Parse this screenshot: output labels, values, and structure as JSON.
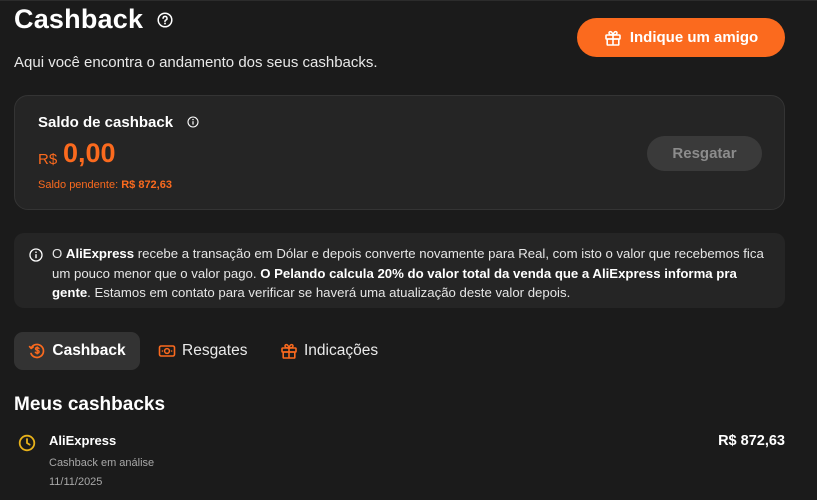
{
  "header": {
    "title": "Cashback",
    "subtitle": "Aqui você encontra o andamento dos seus cashbacks.",
    "invite_label": "Indique um amigo"
  },
  "balance": {
    "label": "Saldo de cashback",
    "currency": "R$",
    "amount": "0,00",
    "pending_label": "Saldo pendente:",
    "pending_value": "R$ 872,63",
    "redeem_label": "Resgatar"
  },
  "notice": {
    "p1": "O ",
    "b1": "AliExpress",
    "p2": " recebe a transação em Dólar e depois converte novamente para Real, com isto o valor que recebemos fica um pouco menor que o valor pago. ",
    "b2": "O Pelando calcula 20% do valor total da venda que a AliExpress informa pra gente",
    "p3": ". Estamos em contato para verificar se haverá uma atualização deste valor depois."
  },
  "tabs": [
    {
      "label": "Cashback",
      "icon": "dollar-circle-icon"
    },
    {
      "label": "Resgates",
      "icon": "banknote-icon"
    },
    {
      "label": "Indicações",
      "icon": "gift-icon"
    }
  ],
  "section": {
    "title": "Meus cashbacks"
  },
  "cashbacks": [
    {
      "store": "AliExpress",
      "status": "Cashback em análise",
      "date": "11/11/2025",
      "value": "R$ 872,63",
      "icon": "clock-icon"
    }
  ],
  "colors": {
    "accent": "#fb6a1e",
    "pending_clock": "#e8b21a",
    "background": "#1b1b1b",
    "card": "#252525"
  }
}
